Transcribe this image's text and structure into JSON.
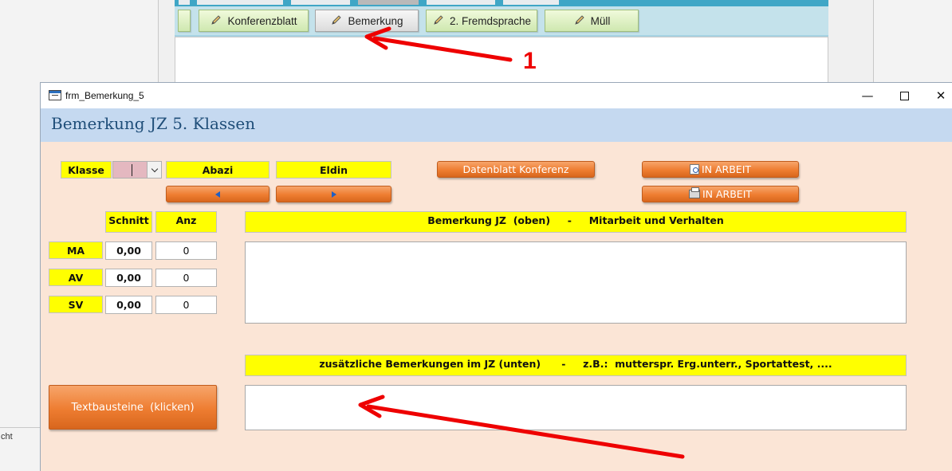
{
  "background": {
    "status_text": "cht",
    "buttons": [
      {
        "label": "Konferenzblatt"
      },
      {
        "label": "Bemerkung"
      },
      {
        "label": "2. Fremdsprache"
      },
      {
        "label": "Müll"
      }
    ],
    "annotation_number": "1"
  },
  "dialog": {
    "window_title": "frm_Bemerkung_5",
    "header_title": "Bemerkung JZ 5. Klassen",
    "klasse_label": "Klasse",
    "klasse_value": "",
    "last_name": "Abazi",
    "first_name": "Eldin",
    "datenblatt_button": "Datenblatt Konferenz",
    "preview_button": "IN ARBEIT",
    "print_button": "IN ARBEIT",
    "stats": {
      "schnitt_header": "Schnitt",
      "anz_header": "Anz",
      "rows": [
        {
          "label": "MA",
          "schnitt": "0,00",
          "anz": "0"
        },
        {
          "label": "AV",
          "schnitt": "0,00",
          "anz": "0"
        },
        {
          "label": "SV",
          "schnitt": "0,00",
          "anz": "0"
        }
      ]
    },
    "top_remark_header": "Bemerkung JZ  (oben)     -     Mitarbeit und Verhalten",
    "bottom_remark_header": "zusätzliche Bemerkungen im JZ (unten)      -     z.B.:  mutterspr. Erg.unterr., Sportattest, ....",
    "textbausteine_button": "Textbausteine  (klicken)"
  },
  "colors": {
    "accent_orange": "#ee7d31",
    "label_yellow": "#ffff00",
    "dialog_bg": "#fbe5d6",
    "header_blue": "#c5d9f0",
    "annotation_red": "#ee0000"
  }
}
